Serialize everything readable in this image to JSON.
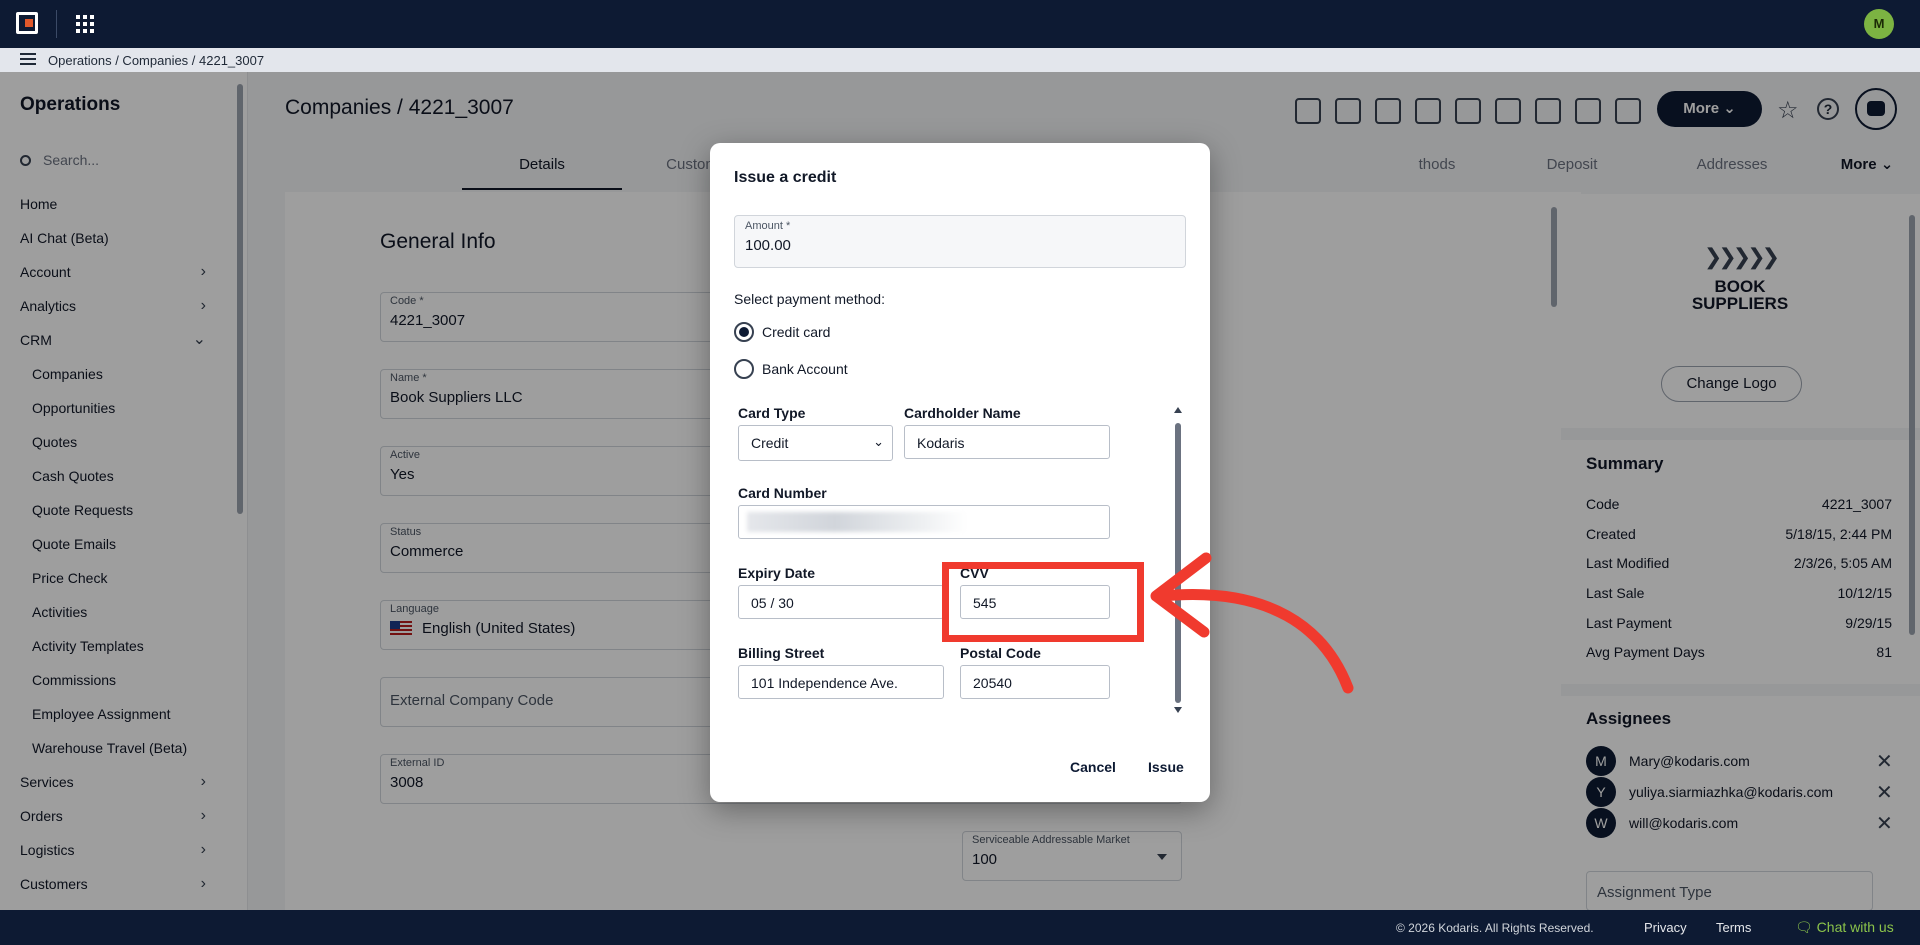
{
  "topbar": {
    "user_initial": "M"
  },
  "breadcrumb": {
    "text": "Operations / Companies / 4221_3007"
  },
  "sidebar": {
    "title": "Operations",
    "search_placeholder": "Search...",
    "items": [
      {
        "label": "Home",
        "sub": false,
        "chevron": ""
      },
      {
        "label": "AI Chat (Beta)",
        "sub": false,
        "chevron": ""
      },
      {
        "label": "Account",
        "sub": false,
        "chevron": "›"
      },
      {
        "label": "Analytics",
        "sub": false,
        "chevron": "›"
      },
      {
        "label": "CRM",
        "sub": false,
        "chevron": "⌄"
      },
      {
        "label": "Companies",
        "sub": true,
        "chevron": ""
      },
      {
        "label": "Opportunities",
        "sub": true,
        "chevron": ""
      },
      {
        "label": "Quotes",
        "sub": true,
        "chevron": ""
      },
      {
        "label": "Cash Quotes",
        "sub": true,
        "chevron": ""
      },
      {
        "label": "Quote Requests",
        "sub": true,
        "chevron": ""
      },
      {
        "label": "Quote Emails",
        "sub": true,
        "chevron": ""
      },
      {
        "label": "Price Check",
        "sub": true,
        "chevron": ""
      },
      {
        "label": "Activities",
        "sub": true,
        "chevron": ""
      },
      {
        "label": "Activity Templates",
        "sub": true,
        "chevron": ""
      },
      {
        "label": "Commissions",
        "sub": true,
        "chevron": ""
      },
      {
        "label": "Employee Assignment",
        "sub": true,
        "chevron": ""
      },
      {
        "label": "Warehouse Travel (Beta)",
        "sub": true,
        "chevron": ""
      },
      {
        "label": "Services",
        "sub": false,
        "chevron": "›"
      },
      {
        "label": "Orders",
        "sub": false,
        "chevron": "›"
      },
      {
        "label": "Logistics",
        "sub": false,
        "chevron": "›"
      },
      {
        "label": "Customers",
        "sub": false,
        "chevron": "›"
      }
    ]
  },
  "header": {
    "title": "Companies / 4221_3007",
    "more_label": "More"
  },
  "tabs": [
    {
      "label": "Details",
      "active": true
    },
    {
      "label": "Custom",
      "active": false
    },
    {
      "label": "thods",
      "active": false
    },
    {
      "label": "Deposit",
      "active": false
    },
    {
      "label": "Addresses",
      "active": false
    },
    {
      "label": "More",
      "active": false
    }
  ],
  "general_info": {
    "title": "General Info",
    "fields": [
      {
        "label": "Code *",
        "value": "4221_3007"
      },
      {
        "label": "Name *",
        "value": "Book Suppliers LLC"
      },
      {
        "label": "Active",
        "value": "Yes"
      },
      {
        "label": "Status",
        "value": "Commerce"
      },
      {
        "label": "Language",
        "value": "English (United States)"
      },
      {
        "label": "",
        "placeholder": "External Company Code"
      },
      {
        "label": "External ID",
        "value": "3008"
      }
    ],
    "serviceable_market": {
      "label": "Serviceable Addressable Market",
      "value": "100"
    }
  },
  "right_panel": {
    "brand_line1": "BOOK",
    "brand_line2": "SUPPLIERS",
    "change_logo": "Change Logo",
    "summary_title": "Summary",
    "summary": [
      {
        "label": "Code",
        "value": "4221_3007"
      },
      {
        "label": "Created",
        "value": "5/18/15, 2:44 PM"
      },
      {
        "label": "Last Modified",
        "value": "2/3/26, 5:05 AM"
      },
      {
        "label": "Last Sale",
        "value": "10/12/15"
      },
      {
        "label": "Last Payment",
        "value": "9/29/15"
      },
      {
        "label": "Avg Payment Days",
        "value": "81"
      }
    ],
    "assignees_title": "Assignees",
    "assignees": [
      {
        "initial": "M",
        "email": "Mary@kodaris.com"
      },
      {
        "initial": "Y",
        "email": "yuliya.siarmiazhka@kodaris.com"
      },
      {
        "initial": "W",
        "email": "will@kodaris.com"
      }
    ],
    "assignment_type_placeholder": "Assignment Type"
  },
  "modal": {
    "title": "Issue a credit",
    "amount_label": "Amount *",
    "amount_value": "100.00",
    "payment_method_label": "Select payment method:",
    "option_credit_card": "Credit card",
    "option_bank_account": "Bank Account",
    "card_type_label": "Card Type",
    "card_type_value": "Credit",
    "cardholder_label": "Cardholder Name",
    "cardholder_value": "Kodaris",
    "card_number_label": "Card Number",
    "expiry_label": "Expiry Date",
    "expiry_value": "05 / 30",
    "cvv_label": "CVV",
    "cvv_value": "545",
    "billing_street_label": "Billing Street",
    "billing_street_value": "101 Independence Ave.",
    "postal_code_label": "Postal Code",
    "postal_code_value": "20540",
    "cancel_label": "Cancel",
    "issue_label": "Issue"
  },
  "footer": {
    "copyright": "© 2026 Kodaris. All Rights Reserved.",
    "privacy": "Privacy",
    "terms": "Terms",
    "chat": "Chat with us"
  },
  "colors": {
    "navy": "#0d1a33",
    "annotation_red": "#f03a2e",
    "chat_green": "#8bc34a"
  }
}
